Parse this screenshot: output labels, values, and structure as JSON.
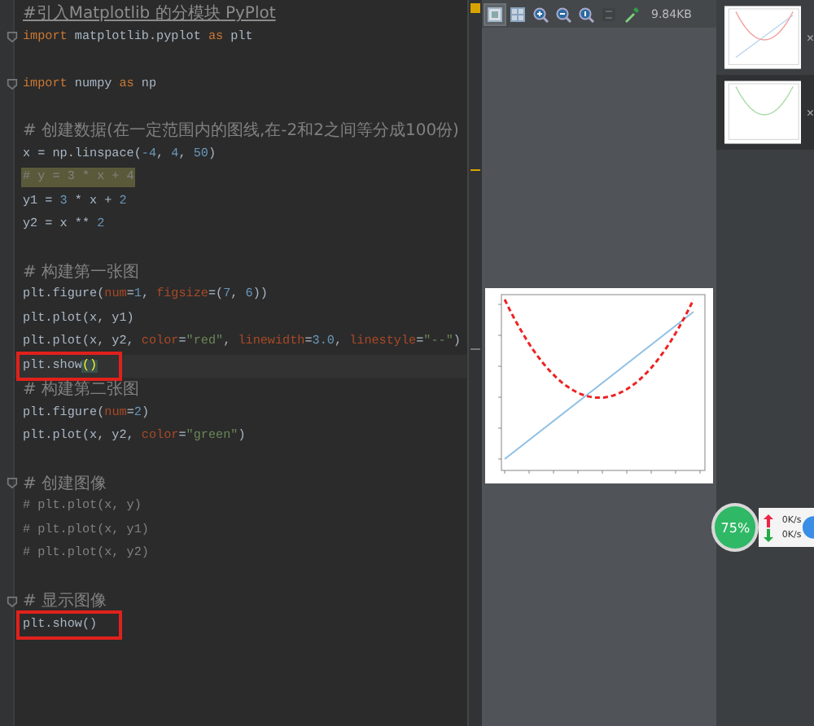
{
  "editor": {
    "blocks": [
      {
        "lines": [
          {
            "segments": [
              {
                "kind": "doc",
                "text": "#引入Matplotlib 的分模块 PyPlot"
              }
            ]
          },
          {
            "fold": true,
            "segments": [
              {
                "kind": "keyword",
                "text": "import"
              },
              {
                "kind": "plain",
                "text": " matplotlib.pyplot "
              },
              {
                "kind": "keyword",
                "text": "as"
              },
              {
                "kind": "plain",
                "text": " plt"
              }
            ]
          }
        ]
      },
      {
        "lines": [
          {
            "fold": true,
            "segments": [
              {
                "kind": "keyword",
                "text": "import"
              },
              {
                "kind": "plain",
                "text": " numpy "
              },
              {
                "kind": "keyword",
                "text": "as"
              },
              {
                "kind": "plain",
                "text": " np"
              }
            ]
          }
        ]
      },
      {
        "lines": [
          {
            "segments": [
              {
                "kind": "note",
                "text": "# 创建数据(在一定范围内的图线,在-2和2之间等分成100份)"
              }
            ]
          },
          {
            "segments": [
              {
                "kind": "plain",
                "text": "x = np.linspace("
              },
              {
                "kind": "number",
                "text": "-4"
              },
              {
                "kind": "plain",
                "text": ", "
              },
              {
                "kind": "number",
                "text": "4"
              },
              {
                "kind": "plain",
                "text": ", "
              },
              {
                "kind": "number",
                "text": "50"
              },
              {
                "kind": "plain",
                "text": ")"
              }
            ]
          },
          {
            "highlighted": true,
            "segments": [
              {
                "kind": "comment",
                "text": "# y = 3 * x + 4"
              }
            ]
          },
          {
            "segments": [
              {
                "kind": "plain",
                "text": "y1 = "
              },
              {
                "kind": "number",
                "text": "3"
              },
              {
                "kind": "plain",
                "text": " * x + "
              },
              {
                "kind": "number",
                "text": "2"
              }
            ]
          },
          {
            "segments": [
              {
                "kind": "plain",
                "text": "y2 = x ** "
              },
              {
                "kind": "number",
                "text": "2"
              }
            ]
          }
        ]
      },
      {
        "lines": [
          {
            "segments": [
              {
                "kind": "note",
                "text": "# 构建第一张图"
              }
            ]
          },
          {
            "segments": [
              {
                "kind": "plain",
                "text": "plt.figure("
              },
              {
                "kind": "param",
                "text": "num"
              },
              {
                "kind": "plain",
                "text": "="
              },
              {
                "kind": "number",
                "text": "1"
              },
              {
                "kind": "plain",
                "text": ", "
              },
              {
                "kind": "param",
                "text": "figsize"
              },
              {
                "kind": "plain",
                "text": "=("
              },
              {
                "kind": "number",
                "text": "7"
              },
              {
                "kind": "plain",
                "text": ", "
              },
              {
                "kind": "number",
                "text": "6"
              },
              {
                "kind": "plain",
                "text": "))"
              }
            ]
          },
          {
            "segments": [
              {
                "kind": "plain",
                "text": "plt.plot(x, y1)"
              }
            ]
          },
          {
            "segments": [
              {
                "kind": "plain",
                "text": "plt.plot(x, y2, "
              },
              {
                "kind": "param",
                "text": "color"
              },
              {
                "kind": "plain",
                "text": "="
              },
              {
                "kind": "string",
                "text": "\"red\""
              },
              {
                "kind": "plain",
                "text": ", "
              },
              {
                "kind": "param",
                "text": "linewidth"
              },
              {
                "kind": "plain",
                "text": "="
              },
              {
                "kind": "number",
                "text": "3.0"
              },
              {
                "kind": "plain",
                "text": ", "
              },
              {
                "kind": "param",
                "text": "linestyle"
              },
              {
                "kind": "plain",
                "text": "="
              },
              {
                "kind": "string",
                "text": "\"--\""
              },
              {
                "kind": "plain",
                "text": ")"
              }
            ]
          },
          {
            "current": true,
            "boxed": true,
            "segments": [
              {
                "kind": "plain",
                "text": "plt.show"
              },
              {
                "kind": "bracket",
                "text": "()"
              }
            ]
          },
          {
            "segments": [
              {
                "kind": "note",
                "text": "# 构建第二张图"
              }
            ]
          },
          {
            "segments": [
              {
                "kind": "plain",
                "text": "plt.figure("
              },
              {
                "kind": "param",
                "text": "num"
              },
              {
                "kind": "plain",
                "text": "="
              },
              {
                "kind": "number",
                "text": "2"
              },
              {
                "kind": "plain",
                "text": ")"
              }
            ]
          },
          {
            "segments": [
              {
                "kind": "plain",
                "text": "plt.plot(x, y2, "
              },
              {
                "kind": "param",
                "text": "color"
              },
              {
                "kind": "plain",
                "text": "="
              },
              {
                "kind": "string",
                "text": "\"green\""
              },
              {
                "kind": "plain",
                "text": ")"
              }
            ]
          }
        ]
      },
      {
        "lines": [
          {
            "fold": true,
            "segments": [
              {
                "kind": "note",
                "text": "# 创建图像"
              }
            ]
          },
          {
            "segments": [
              {
                "kind": "comment",
                "text": "# plt.plot(x, y)"
              }
            ]
          },
          {
            "segments": [
              {
                "kind": "comment",
                "text": "# plt.plot(x, y1)"
              }
            ]
          },
          {
            "segments": [
              {
                "kind": "comment",
                "text": "# plt.plot(x, y2)"
              }
            ]
          }
        ]
      },
      {
        "lines": [
          {
            "fold": true,
            "segments": [
              {
                "kind": "note",
                "text": "# 显示图像"
              }
            ]
          },
          {
            "boxed": true,
            "segments": [
              {
                "kind": "plain",
                "text": "plt.show()"
              }
            ]
          }
        ]
      }
    ]
  },
  "viewer": {
    "toolbar": [
      {
        "kind": "fit",
        "selected": true
      },
      {
        "kind": "actual",
        "selected": false
      },
      {
        "kind": "zoom-in",
        "selected": false
      },
      {
        "kind": "zoom-out",
        "selected": false
      },
      {
        "kind": "zoom-reset",
        "selected": false
      },
      {
        "kind": "compare",
        "selected": false
      },
      {
        "kind": "picker",
        "selected": false
      }
    ],
    "file_size": "9.84KB"
  },
  "thumbnails": [
    {
      "kind": "red-blue",
      "selected": false,
      "close": "×"
    },
    {
      "kind": "green",
      "selected": true,
      "close": "×"
    }
  ],
  "network_widget": {
    "percent": "75%",
    "upload": "0K/s",
    "download": "0K/s"
  }
}
